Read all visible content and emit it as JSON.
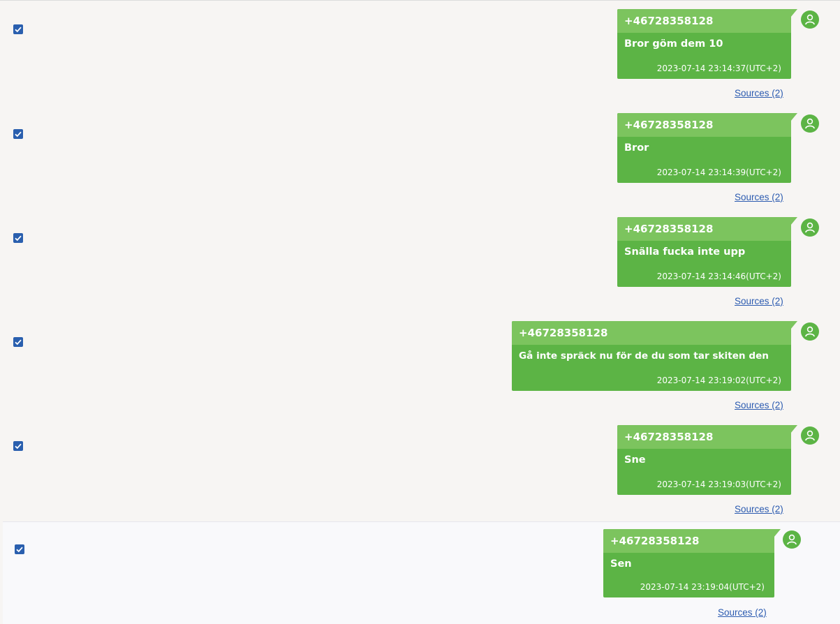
{
  "messages": [
    {
      "sender": "+46728358128",
      "text": "Bror göm dem 10",
      "timestamp": "2023-07-14 23:14:37(UTC+2)",
      "sources": "Sources (2)",
      "checked": true
    },
    {
      "sender": "+46728358128",
      "text": "Bror",
      "timestamp": "2023-07-14 23:14:39(UTC+2)",
      "sources": "Sources (2)",
      "checked": true
    },
    {
      "sender": "+46728358128",
      "text": "Snälla fucka inte upp",
      "timestamp": "2023-07-14 23:14:46(UTC+2)",
      "sources": "Sources (2)",
      "checked": true
    },
    {
      "sender": "+46728358128",
      "text": "Gå inte spräck nu för de du som tar skiten den",
      "timestamp": "2023-07-14 23:19:02(UTC+2)",
      "sources": "Sources (2)",
      "checked": true
    },
    {
      "sender": "+46728358128",
      "text": "Sne",
      "timestamp": "2023-07-14 23:19:03(UTC+2)",
      "sources": "Sources (2)",
      "checked": true
    },
    {
      "sender": "+46728358128",
      "text": "Sen",
      "timestamp": "2023-07-14 23:19:04(UTC+2)",
      "sources": "Sources (2)",
      "checked": true
    }
  ],
  "colors": {
    "bubble": "#5cb445",
    "bubble_header": "#7cc45e",
    "checkbox": "#2a5fae",
    "link": "#2c5bb0"
  },
  "icons": {
    "avatar": "user-avatar-icon",
    "checkbox": "checkmark-icon"
  }
}
